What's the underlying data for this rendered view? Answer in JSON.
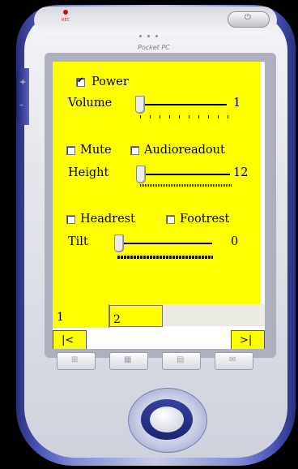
{
  "device": {
    "brand": "Pocket PC",
    "rec_label": "REC",
    "power_glyph": "⏻",
    "side_up": "+",
    "side_down": "–",
    "hw_icons": [
      "windows-logo-icon",
      "calendar-icon",
      "contacts-icon",
      "inbox-icon"
    ],
    "hw_glyphs": [
      "⊞",
      "▦",
      "▤",
      "✉"
    ]
  },
  "app": {
    "power": {
      "label": "Power",
      "checked": true
    },
    "volume": {
      "label": "Volume",
      "value": "1",
      "fraction": 0.0
    },
    "mute": {
      "label": "Mute",
      "checked": false
    },
    "audioreadout": {
      "label": "Audioreadout",
      "checked": false
    },
    "height": {
      "label": "Height",
      "value": "12",
      "fraction": 0.0
    },
    "headrest": {
      "label": "Headrest",
      "checked": false
    },
    "footrest": {
      "label": "Footrest",
      "checked": false
    },
    "tilt": {
      "label": "Tilt",
      "value": "0",
      "fraction": 0.0
    },
    "tabs": [
      {
        "label": "1",
        "active": true
      },
      {
        "label": "2",
        "active": false
      }
    ],
    "nav": {
      "prev_label": "|<",
      "next_label": ">|"
    }
  },
  "colors": {
    "panel": "#ffff00",
    "device_accent": "#3a44a8"
  }
}
